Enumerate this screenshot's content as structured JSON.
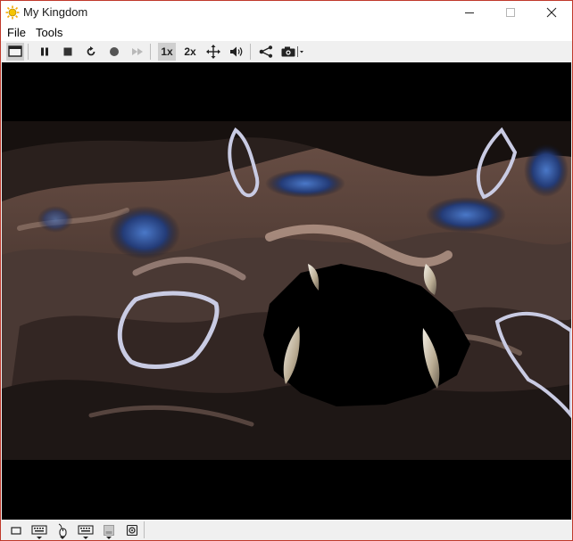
{
  "window": {
    "title": "My Kingdom",
    "app_icon": "sun-icon"
  },
  "menu": {
    "items": [
      "File",
      "Tools"
    ]
  },
  "toolbar": {
    "buttons": [
      "display-icon",
      "pause-icon",
      "stop-icon",
      "reset-icon",
      "record-icon",
      "fast-forward-icon",
      "1x",
      "2x",
      "move-icon",
      "volume-icon",
      "share-icon",
      "camera-icon"
    ],
    "scale_1x": "1x",
    "scale_2x": "2x"
  },
  "statusbar": {
    "icons": [
      "media-icon",
      "keyboard-icon",
      "mouse-icon",
      "keyboard-alt-icon",
      "disk-icon",
      "speaker-icon"
    ]
  }
}
